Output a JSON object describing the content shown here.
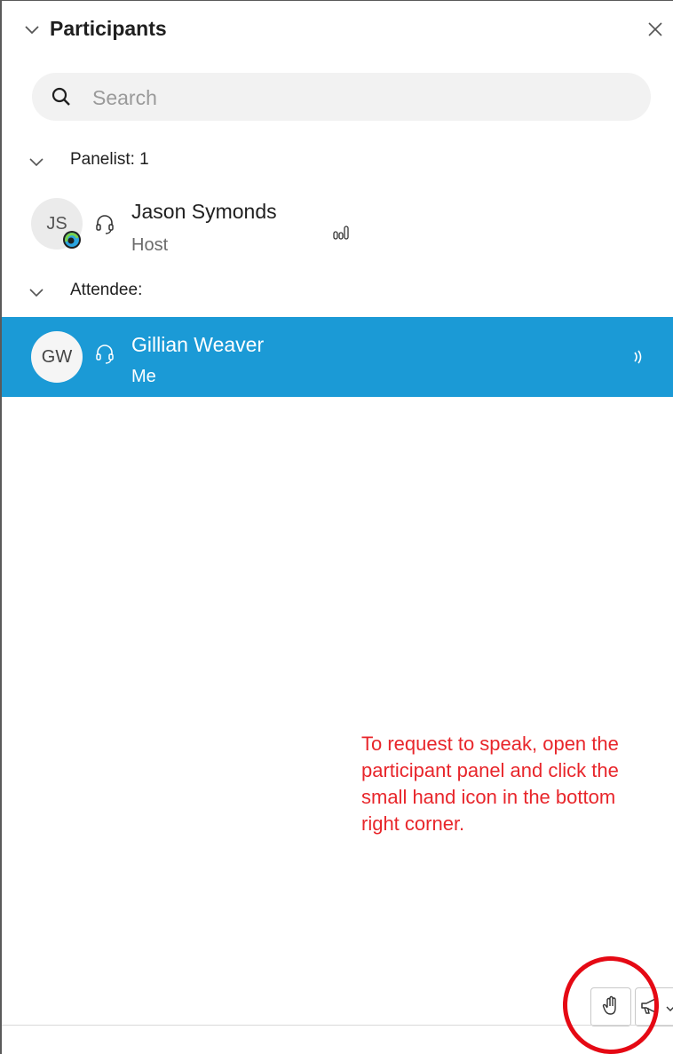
{
  "header": {
    "title": "Participants",
    "close_icon": "close-icon",
    "collapse_icon": "chevron-down-icon"
  },
  "search": {
    "placeholder": "Search",
    "value": "",
    "icon": "search-icon"
  },
  "groups": [
    {
      "label": "Panelist: 1",
      "members": [
        {
          "initials": "JS",
          "name": "Jason Symonds",
          "role": "Host",
          "audio_icon": "headset-icon",
          "status_icon": "audio-level-icon",
          "badge_icon": "webex-badge-icon",
          "selected": false
        }
      ]
    },
    {
      "label": "Attendee:",
      "members": [
        {
          "initials": "GW",
          "name": "Gillian Weaver",
          "role": "Me",
          "audio_icon": "headset-icon",
          "status_icon": "speaking-icon",
          "selected": true
        }
      ]
    }
  ],
  "annotation": {
    "text": "To request to speak, open the participant panel and click the small hand icon in the bottom right corner.",
    "color": "#e8262b"
  },
  "footer": {
    "raise_hand_icon": "raise-hand-icon",
    "mute_all_icon": "megaphone-icon"
  },
  "colors": {
    "selected_row": "#1b9ad6",
    "annotation_circle": "#e50914"
  }
}
